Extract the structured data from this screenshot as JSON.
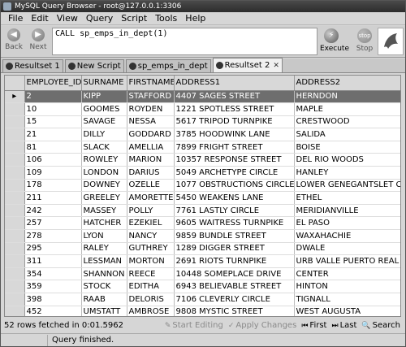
{
  "window": {
    "title": "MySQL Query Browser - root@127.0.0.1:3306"
  },
  "menu": [
    "File",
    "Edit",
    "View",
    "Query",
    "Script",
    "Tools",
    "Help"
  ],
  "toolbar": {
    "back_label": "Back",
    "next_label": "Next",
    "query_text": "CALL sp_emps_in_dept(1)",
    "execute_label": "Execute",
    "stop_label": "Stop",
    "stop_icon_text": "stop"
  },
  "tabs": [
    {
      "label": "Resultset 1",
      "active": false
    },
    {
      "label": "New Script",
      "active": false
    },
    {
      "label": "sp_emps_in_dept",
      "active": false
    },
    {
      "label": "Resultset 2",
      "active": true
    }
  ],
  "table": {
    "columns": [
      "EMPLOYEE_ID",
      "SURNAME",
      "FIRSTNAME",
      "ADDRESS1",
      "ADDRESS2"
    ],
    "rows": [
      [
        "2",
        "KIPP",
        "STAFFORD",
        "4407 SAGES STREET",
        "HERNDON"
      ],
      [
        "10",
        "GOOMES",
        "ROYDEN",
        "1221 SPOTLESS STREET",
        "MAPLE"
      ],
      [
        "15",
        "SAVAGE",
        "NESSA",
        "5617 TRIPOD TURNPIKE",
        "CRESTWOOD"
      ],
      [
        "21",
        "DILLY",
        "GODDARD",
        "3785 HOODWINK LANE",
        "SALIDA"
      ],
      [
        "81",
        "SLACK",
        "AMELLIA",
        "7899 FRIGHT STREET",
        "BOISE"
      ],
      [
        "106",
        "ROWLEY",
        "MARION",
        "10357 RESPONSE STREET",
        "DEL RIO WOODS"
      ],
      [
        "109",
        "LONDON",
        "DARIUS",
        "5049 ARCHETYPE CIRCLE",
        "HANLEY"
      ],
      [
        "178",
        "DOWNEY",
        "OZELLE",
        "1077 OBSTRUCTIONS CIRCLE",
        "LOWER GENEGANTSLET CORNER"
      ],
      [
        "211",
        "GREELEY",
        "AMORETTE",
        "5450 WEAKENS LANE",
        "ETHEL"
      ],
      [
        "242",
        "MASSEY",
        "POLLY",
        "7761 LASTLY CIRCLE",
        "MERIDIANVILLE"
      ],
      [
        "257",
        "HATCHER",
        "EZEKIEL",
        "9605 WAITRESS TURNPIKE",
        "EL PASO"
      ],
      [
        "278",
        "LYON",
        "NANCY",
        "9859 BUNDLE STREET",
        "WAXAHACHIE"
      ],
      [
        "295",
        "RALEY",
        "GUTHREY",
        "1289 DIGGER STREET",
        "DWALE"
      ],
      [
        "311",
        "LESSMAN",
        "MORTON",
        "2691 RIOTS TURNPIKE",
        "URB VALLE PUERTO REAL"
      ],
      [
        "354",
        "SHANNON",
        "REECE",
        "10448 SOMEPLACE DRIVE",
        "CENTER"
      ],
      [
        "359",
        "STOCK",
        "EDITHA",
        "6943 BELIEVABLE STREET",
        "HINTON"
      ],
      [
        "398",
        "RAAB",
        "DELORIS",
        "7106 CLEVERLY CIRCLE",
        "TIGNALL"
      ],
      [
        "452",
        "UMSTATT",
        "AMBROSE",
        "9808 MYSTIC STREET",
        "WEST AUGUSTA"
      ]
    ],
    "selected_row": 0
  },
  "status": {
    "rows_fetched": "52 rows fetched in 0:01.5962",
    "start_editing": "Start Editing",
    "apply_changes": "Apply Changes",
    "first": "First",
    "last": "Last",
    "search": "Search",
    "message": "Query finished."
  },
  "colors": {
    "selected_row": "#6e6e6e",
    "header_bg": "#d8d8d8"
  }
}
